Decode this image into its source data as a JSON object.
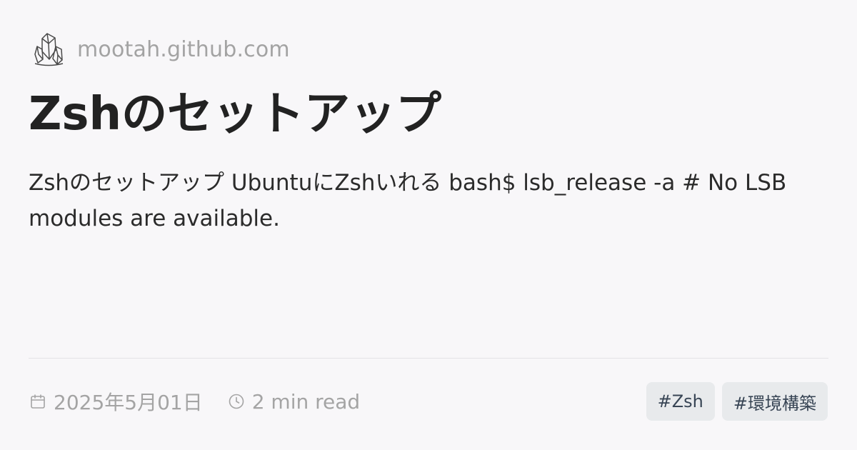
{
  "site": {
    "name": "mootah.github.com",
    "logo_icon": "crystal-cluster-icon"
  },
  "post": {
    "title": "Zshのセットアップ",
    "description": "Zshのセットアップ UbuntuにZshいれる bash$ lsb_release -a # No LSB modules are available.",
    "date": "2025年5月01日",
    "read_time": "2 min read"
  },
  "meta_icons": {
    "date": "calendar-icon",
    "read_time": "clock-icon"
  },
  "tags": [
    {
      "label": "#Zsh"
    },
    {
      "label": "#環境構築"
    }
  ],
  "colors": {
    "background": "#f8f7f9",
    "title": "#222222",
    "muted": "#a4a4a4",
    "tag_background": "#e8eaec",
    "tag_text": "#384555"
  }
}
